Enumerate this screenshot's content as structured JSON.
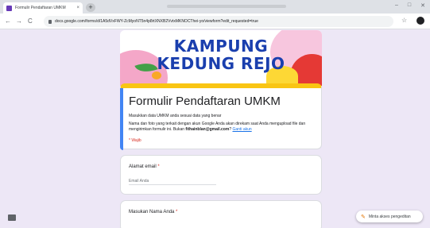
{
  "browser": {
    "tab_title": "Formulir Pendaftaran UMKM",
    "tab_close": "×",
    "new_tab": "+",
    "url": "docs.google.com/forms/d/1A5dVxFWY-ZcMyoNT5n4p8rtXNXB2VvtxMKNOCThei-yo/viewform?edit_requested=true",
    "nav_back": "←",
    "nav_forward": "→",
    "nav_reload": "C",
    "star": "☆",
    "window_min": "–",
    "window_max": "□",
    "window_close": "✕"
  },
  "banner": {
    "line1": "KAMPUNG",
    "line2": "KEDUNG REJO"
  },
  "form": {
    "title": "Formulir Pendaftaran UMKM",
    "description": "Masukkan data UMKM anda sesuai data yang benar",
    "signin_text_pre": "Nama dan foto yang terkait dengan akun Google Anda akan direkam saat Anda mengupload file dan mengirimkan formulir ini. Bukan ",
    "signin_email": "fithainblan@gmail.com",
    "signin_text_post": "? ",
    "switch_account": "Ganti akun",
    "required_note": "* Wajib"
  },
  "questions": [
    {
      "label": "Alamat email",
      "required_mark": " *",
      "placeholder": "Email Anda"
    },
    {
      "label": "Masukan Nama Anda",
      "required_mark": " *",
      "placeholder": ""
    }
  ],
  "footer": {
    "edit_access_label": "Minta akses pengeditan"
  },
  "colors": {
    "form_bg": "#ede7f6",
    "banner_title": "#1a3fae",
    "title_card_top": "#f9c513",
    "required": "#d93025",
    "link": "#1a73e8"
  }
}
